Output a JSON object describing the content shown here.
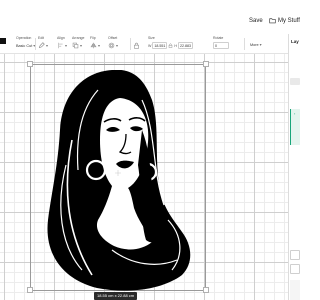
{
  "header": {
    "save_label": "Save",
    "my_stuff_label": "My Stuff"
  },
  "toolbar": {
    "operation": {
      "label": "Operation",
      "value": "Basic Cut"
    },
    "deselect_label": "Deselect",
    "edit_label": "Edit",
    "align_label": "Align",
    "arrange_label": "Arrange",
    "flip_label": "Flip",
    "offset_label": "Offset",
    "size": {
      "label": "Size",
      "w_prefix": "W",
      "w_value": "18.551",
      "h_prefix": "H",
      "h_value": "22.883"
    },
    "rotate": {
      "label": "Rotate",
      "value": "0"
    },
    "more_label": "More"
  },
  "right_panel": {
    "tab_label": "Lay"
  },
  "canvas": {
    "image_name": "woman-long-hair-silhouette",
    "dimension_tooltip": "18.55 cm x 22.88 cm"
  },
  "colors": {
    "accent": "#19a67a",
    "art_fill": "#000000",
    "grid_major": "#cfcfcf",
    "grid_minor": "#ececec"
  }
}
